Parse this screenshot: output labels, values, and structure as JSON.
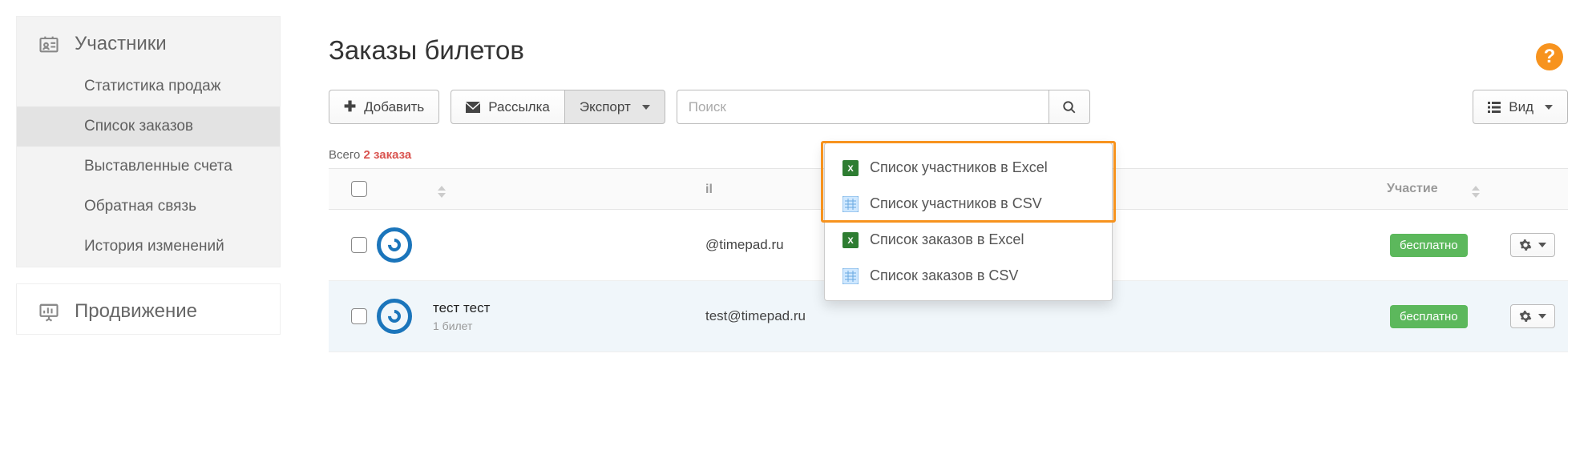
{
  "sidebar": {
    "participants_header": "Участники",
    "items": [
      {
        "label": "Статистика продаж",
        "active": false
      },
      {
        "label": "Список заказов",
        "active": true
      },
      {
        "label": "Выставленные счета",
        "active": false
      },
      {
        "label": "Обратная связь",
        "active": false
      },
      {
        "label": "История изменений",
        "active": false
      }
    ],
    "promotion_header": "Продвижение"
  },
  "page": {
    "title": "Заказы билетов"
  },
  "toolbar": {
    "add_label": "Добавить",
    "mailing_label": "Рассылка",
    "export_label": "Экспорт",
    "view_label": "Вид"
  },
  "search": {
    "placeholder": "Поиск",
    "value": ""
  },
  "summary": {
    "prefix": "Всего ",
    "count_text": "2 заказа"
  },
  "table": {
    "headers": {
      "email_visible": "il",
      "participation": "Участие"
    },
    "rows": [
      {
        "name": "",
        "sub": "",
        "email_visible": "@timepad.ru",
        "tag": "бесплатно"
      },
      {
        "name": "тест тест",
        "sub": "1 билет",
        "email_visible": "test@timepad.ru",
        "tag": "бесплатно"
      }
    ]
  },
  "export_menu": {
    "items": [
      {
        "icon": "excel",
        "label": "Список участников в Excel"
      },
      {
        "icon": "csv",
        "label": "Список участников в CSV"
      },
      {
        "icon": "excel",
        "label": "Список заказов в Excel"
      },
      {
        "icon": "csv",
        "label": "Список заказов в CSV"
      }
    ]
  },
  "icons": {
    "help": "?"
  }
}
